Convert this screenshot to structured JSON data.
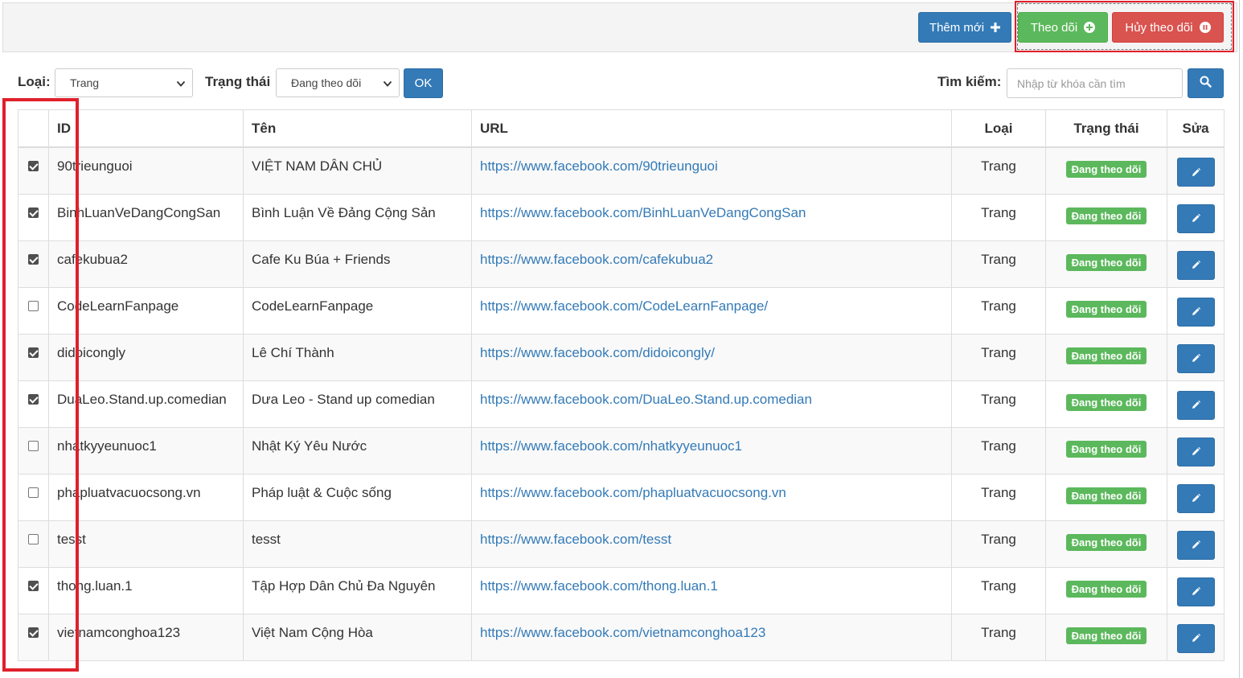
{
  "toolbar": {
    "add_label": "Thêm mới",
    "follow_label": "Theo dõi",
    "unfollow_label": "Hủy theo dõi"
  },
  "filters": {
    "type_label": "Loại:",
    "type_value": "Trang",
    "status_label": "Trạng thái",
    "status_value": "Đang theo dõi",
    "ok_label": "OK",
    "search_label": "Tìm kiếm:",
    "search_placeholder": "Nhập từ khóa cần tìm"
  },
  "table": {
    "headers": [
      "",
      "ID",
      "Tên",
      "URL",
      "Loại",
      "Trạng thái",
      "Sửa"
    ],
    "rows": [
      {
        "checked": true,
        "id": "90trieunguoi",
        "name": "VIỆT NAM DÂN CHỦ",
        "url": "https://www.facebook.com/90trieunguoi",
        "type": "Trang",
        "status": "Đang theo dõi"
      },
      {
        "checked": true,
        "id": "BinhLuanVeDangCongSan",
        "name": "Bình Luận Về Đảng Cộng Sản",
        "url": "https://www.facebook.com/BinhLuanVeDangCongSan",
        "type": "Trang",
        "status": "Đang theo dõi"
      },
      {
        "checked": true,
        "id": "cafekubua2",
        "name": "Cafe Ku Búa + Friends",
        "url": "https://www.facebook.com/cafekubua2",
        "type": "Trang",
        "status": "Đang theo dõi"
      },
      {
        "checked": false,
        "id": "CodeLearnFanpage",
        "name": "CodeLearnFanpage",
        "url": "https://www.facebook.com/CodeLearnFanpage/",
        "type": "Trang",
        "status": "Đang theo dõi"
      },
      {
        "checked": true,
        "id": "didoicongly",
        "name": "Lê Chí Thành",
        "url": "https://www.facebook.com/didoicongly/",
        "type": "Trang",
        "status": "Đang theo dõi"
      },
      {
        "checked": true,
        "id": "DuaLeo.Stand.up.comedian",
        "name": "Dưa Leo - Stand up comedian",
        "url": "https://www.facebook.com/DuaLeo.Stand.up.comedian",
        "type": "Trang",
        "status": "Đang theo dõi"
      },
      {
        "checked": false,
        "id": "nhatkyyeunuoc1",
        "name": "Nhật Ký Yêu Nước",
        "url": "https://www.facebook.com/nhatkyyeunuoc1",
        "type": "Trang",
        "status": "Đang theo dõi"
      },
      {
        "checked": false,
        "id": "phapluatvacuocsong.vn",
        "name": "Pháp luật & Cuộc sống",
        "url": "https://www.facebook.com/phapluatvacuocsong.vn",
        "type": "Trang",
        "status": "Đang theo dõi"
      },
      {
        "checked": false,
        "id": "tesst",
        "name": "tesst",
        "url": "https://www.facebook.com/tesst",
        "type": "Trang",
        "status": "Đang theo dõi"
      },
      {
        "checked": true,
        "id": "thong.luan.1",
        "name": "Tập Hợp Dân Chủ Đa Nguyên",
        "url": "https://www.facebook.com/thong.luan.1",
        "type": "Trang",
        "status": "Đang theo dõi"
      },
      {
        "checked": true,
        "id": "vietnamconghoa123",
        "name": "Việt Nam Cộng Hòa",
        "url": "https://www.facebook.com/vietnamconghoa123",
        "type": "Trang",
        "status": "Đang theo dõi"
      }
    ]
  },
  "icons": {
    "add": "plus-icon",
    "follow": "plus-circle-icon",
    "unfollow": "pause-circle-icon",
    "search": "search-icon",
    "edit": "pencil-icon"
  },
  "colors": {
    "primary": "#337ab7",
    "success": "#5cb85c",
    "danger": "#d9534f",
    "highlight": "#e0202b"
  }
}
